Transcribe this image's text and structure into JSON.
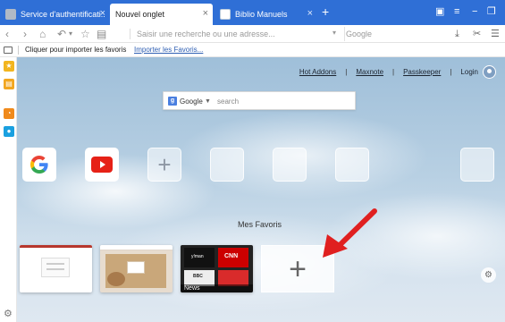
{
  "tabs": [
    {
      "title": "Service d'authentificati...",
      "active": false,
      "favicon_color": "#b0b9c6"
    },
    {
      "title": "Nouvel onglet",
      "active": true,
      "favicon_color": null
    },
    {
      "title": "Biblio Manuels",
      "active": false,
      "favicon_color": "#ffffff"
    }
  ],
  "navbar": {
    "url_placeholder": "Saisir une recherche ou une adresse...",
    "search_placeholder": "Google"
  },
  "bookmarks_bar": {
    "import_text": "Cliquer pour importer les favoris",
    "import_link": "Importer les Favoris..."
  },
  "header_links": {
    "hot_addons": "Hot Addons",
    "sep1": "|",
    "maxnote": "Maxnote",
    "sep2": "|",
    "passkeeper": "Passkeeper",
    "sep3": "|",
    "login": "Login"
  },
  "search_box": {
    "engine": "Google",
    "placeholder": "search"
  },
  "favorites_title": "Mes Favoris",
  "quick_tiles": [
    {
      "name": "google",
      "icon": "google-logo"
    },
    {
      "name": "youtube",
      "icon": "youtube-logo"
    },
    {
      "name": "add",
      "icon": "plus-icon"
    },
    {
      "name": "empty"
    },
    {
      "name": "empty"
    },
    {
      "name": "empty"
    },
    {
      "name": "empty"
    }
  ],
  "thumbnails": {
    "news_label": "News",
    "cnn_label": "CNN",
    "bbc_label": "BBC",
    "yman_label": "y!man"
  },
  "colors": {
    "tabbar": "#2f6fd6",
    "annotation_arrow": "#e02020"
  }
}
